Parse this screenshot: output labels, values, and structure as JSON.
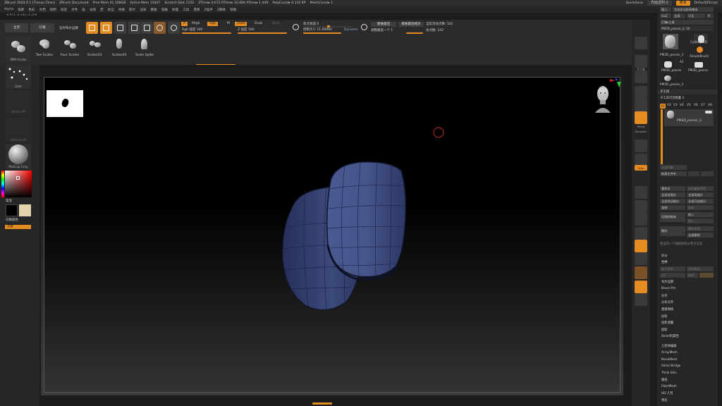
{
  "title_bar": {
    "app": "ZBrush 2024.0.1 [Tianao Chen]",
    "document": "ZBrush Document",
    "free_mem": "Free Mem 41.168GB",
    "active_mem": "Active Mem 13447",
    "scratch": "Scratch Disk 1152",
    "ztime": "ZTime▸ 4.672 RTime▸ 10.084 ATime▸ 1.446",
    "polycount": "PolyCount▸ 0.132 KP",
    "meshcount": "MeshCount▸ 1",
    "quicksave": "QuickSave",
    "transparency": "界面透明 0",
    "menus_btn": "菜单",
    "script": "DefaultZScript"
  },
  "menubar": [
    "Alpha",
    "笔刷",
    "色彩",
    "文档",
    "绘制",
    "动态",
    "文件",
    "层",
    "光照",
    "宏",
    "标记",
    "材质",
    "影片",
    "渲染",
    "模板",
    "笔触",
    "纹理",
    "工具",
    "变换",
    "Z插件",
    "Z脚本",
    "帮助"
  ],
  "coords": "-0.971,-4.331,-2.159",
  "toolbar": {
    "home": "主页",
    "lightbox": "灯箱",
    "live_boolean": "实时布尔运算",
    "a_tag": "A",
    "mrgb": "Mrgb",
    "rgb": "Rgb",
    "m": "M",
    "zadd": "Zadd",
    "zsub": "Zsub",
    "zcut": "Zcut",
    "rgb_intensity": "Rgb 强度 100",
    "z_intensity": "Z 强度 100",
    "focal_shift": "焦点衰减 0",
    "draw_size": "绘制大小 11.69984",
    "dynamic": "Dynamic",
    "redo_last": "重做最后",
    "redo_last_rel": "重做最后相对",
    "adjust_last": "调整最后一个 1",
    "active_points": "当前活动点数: 142",
    "total_points": "总点数: 142"
  },
  "brushes": [
    "Two Scales",
    "Four Scales",
    "Scales03",
    "Scales04",
    "Scale Spike"
  ],
  "left_shelf": {
    "brush_name": "IMM Scales",
    "stroke_name": "Dots",
    "alpha_name": "Alpha Off",
    "texture_name": "Texture Off",
    "material_name": "MatCap Gray",
    "gradient": "渐变",
    "switch_color": "切换颜色",
    "alternate": "交替"
  },
  "right_shelf": {
    "subtool_label": "子工具",
    "persp": "Persp",
    "floor": "地面",
    "dynamic": "Dynamic",
    "solo": "Solo"
  },
  "palette": {
    "row1": [
      "载入",
      "生成多边形网格体"
    ],
    "row2": [
      "GoZ",
      "全部",
      "可见",
      "R"
    ],
    "lightbox_tools": "灯箱▸工具",
    "current_tool": "PM3D_pieces_3. 50",
    "thumbs": [
      "PM3D_pieces_3",
      "Cylinder3D",
      "SimpleBrush",
      "PM3D_pieces",
      "PM3D_pieces",
      "PM3D_pieces_3"
    ],
    "thumb_count": "42",
    "subtool_header": "子工具",
    "subtool_visible": "子工具可见数量 4",
    "versions": [
      "V1",
      "V2",
      "V3",
      "V4",
      "V5",
      "V6",
      "V7",
      "V8"
    ],
    "subtool_item": "PM3D_pieces_3",
    "list_all": "全部列表",
    "new_folder": "新建文件夹",
    "ops": [
      [
        "重命名",
        "自动重新排序"
      ],
      [
        "全部低细分",
        "全部高细分"
      ],
      [
        "全部关闭细分",
        "全部开启细分"
      ],
      [
        "复制",
        "追加"
      ],
      [
        "切割网格体",
        "插入"
      ],
      [
        "删除",
        "删除其他"
      ],
      [
        "",
        "全部删除"
      ]
    ],
    "hint": "将当前一个网格体拆分到子工具",
    "split": "拆分",
    "merge": "合并",
    "merge_down": "向下合并",
    "merge_similar": "合并相似",
    "uv": "UV",
    "weld": "焊接",
    "boolean": "布尔运算",
    "bevel_pro": "Bevel Pro",
    "align": "对齐",
    "distribute": "分布对齐",
    "remesh": "重建网格",
    "project": "投射",
    "extract": "投影测量",
    "extract2": "提取",
    "relief": "Relief的属性",
    "geometry_edit": "几何体编辑",
    "arraymesh": "ArrayMesh",
    "nanomesh": "NanoMesh",
    "slime": "Slime Bridge",
    "thick": "Thick Skin",
    "layers": "图层",
    "fibermesh": "FiberMesh",
    "hd": "HD 几何",
    "preview": "预览"
  },
  "colors": {
    "accent": "#e48b21",
    "mesh": "#3b4a7a",
    "background": "#1c1c1c"
  }
}
